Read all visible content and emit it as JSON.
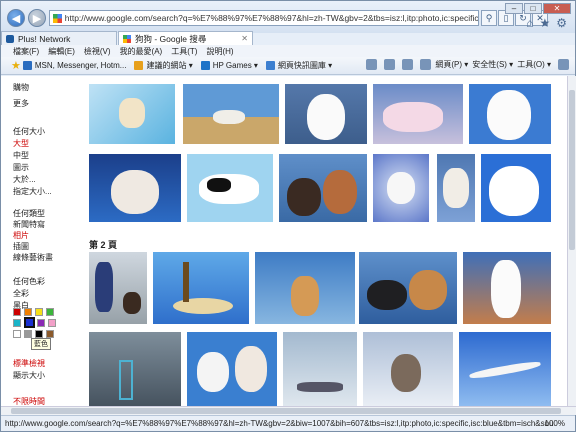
{
  "browser": {
    "url": "http://www.google.com/search?q=%E7%88%97%E7%88%97&hl=zh-TW&gbv=2&tbs=isz:l,itp:photo,ic:specific,isc:blue&tbm=isch&q",
    "tabs": [
      {
        "label": "Plus! Network"
      },
      {
        "label": "狗狗 - Google 搜尋"
      }
    ],
    "menu": [
      "檔案(F)",
      "編輯(E)",
      "檢視(V)",
      "我的最愛(A)",
      "工具(T)",
      "說明(H)"
    ],
    "favorites": [
      {
        "label": "MSN, Messenger, Hotm...",
        "color": "#2a6cc0"
      },
      {
        "label": "建議的網站 ▾",
        "color": "#e7a01c"
      },
      {
        "label": "HP Games ▾",
        "color": "#1d73c8"
      },
      {
        "label": "網頁快訊圖庫 ▾",
        "color": "#3c7fd0"
      }
    ],
    "commands": {
      "page": "網頁(P) ▾",
      "safety": "安全性(S) ▾",
      "tools": "工具(O) ▾"
    },
    "status_url": "http://www.google.com/search?q=%E7%88%97%E7%88%97&hl=zh-TW&gbv=2&biw=1007&bih=607&tbs=isz:l,itp:photo,ic:specific,isc:blue&tbm=isch&sou",
    "zoom": "100%"
  },
  "sidebar": {
    "shopping": "購物",
    "more": "更多",
    "size_head": "任何大小",
    "size_large": "大型",
    "size_medium": "中型",
    "size_icon": "圖示",
    "size_larger": "大於...",
    "size_exact": "指定大小...",
    "type_head": "任何類型",
    "type_news": "新聞特寫",
    "type_photo": "相片",
    "type_clipart": "插圖",
    "type_lineart": "線條藝術畫",
    "color_head": "任何色彩",
    "color_full": "全彩",
    "color_bw": "黑白",
    "swatch_tooltip": "藍色",
    "label_std": "標準檢視",
    "show_size": "顯示大小",
    "any_time": "不限時間"
  },
  "results": {
    "page2_label": "第 2 頁"
  }
}
